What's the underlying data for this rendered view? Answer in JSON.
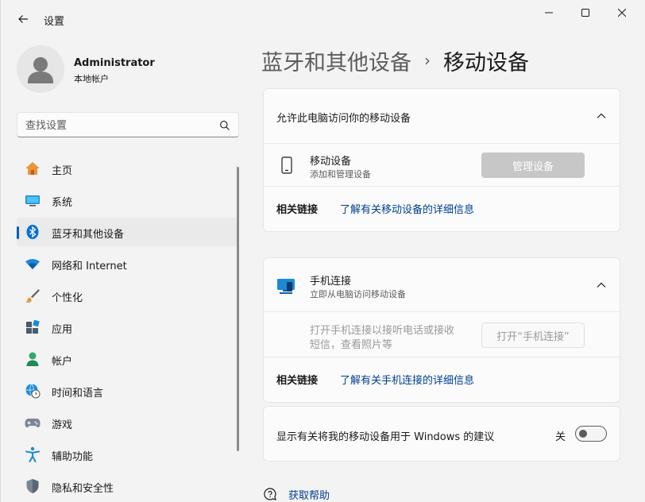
{
  "window": {
    "title": "设置"
  },
  "profile": {
    "name": "Administrator",
    "account_type": "本地帐户"
  },
  "search": {
    "placeholder": "查找设置"
  },
  "nav": {
    "items": [
      {
        "label": "主页",
        "icon": "home-icon"
      },
      {
        "label": "系统",
        "icon": "system-icon"
      },
      {
        "label": "蓝牙和其他设备",
        "icon": "bluetooth-icon",
        "active": true
      },
      {
        "label": "网络和 Internet",
        "icon": "wifi-icon"
      },
      {
        "label": "个性化",
        "icon": "brush-icon"
      },
      {
        "label": "应用",
        "icon": "apps-icon"
      },
      {
        "label": "帐户",
        "icon": "account-icon"
      },
      {
        "label": "时间和语言",
        "icon": "globe-clock-icon"
      },
      {
        "label": "游戏",
        "icon": "gamepad-icon"
      },
      {
        "label": "辅助功能",
        "icon": "accessibility-icon"
      },
      {
        "label": "隐私和安全性",
        "icon": "shield-icon"
      }
    ]
  },
  "breadcrumb": {
    "parent": "蓝牙和其他设备",
    "separator": "›",
    "current": "移动设备"
  },
  "card1": {
    "header": "允许此电脑访问你的移动设备",
    "device_title": "移动设备",
    "device_sub": "添加和管理设备",
    "manage_button": "管理设备",
    "related_label": "相关链接",
    "related_link": "了解有关移动设备的详细信息"
  },
  "card2": {
    "title": "手机连接",
    "subtitle": "立即从电脑访问移动设备",
    "description_line1": "打开手机连接以接听电话或接收",
    "description_line2": "短信，查看照片等",
    "open_button": "打开“手机连接”",
    "related_label": "相关链接",
    "related_link": "了解有关手机连接的详细信息"
  },
  "card3": {
    "label": "显示有关将我的移动设备用于 Windows 的建议",
    "toggle_state": "关"
  },
  "help": {
    "label": "获取帮助"
  },
  "colors": {
    "accent": "#005fb8",
    "link": "#003e92",
    "background": "#f3f3f3",
    "card": "#fbfbfb"
  }
}
